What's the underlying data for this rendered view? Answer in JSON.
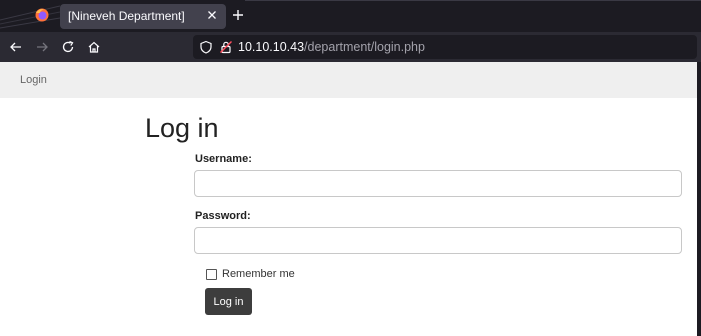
{
  "browser": {
    "tab_title": "[Nineveh Department]",
    "url_host": "10.10.10.43",
    "url_path": "/department/login.php"
  },
  "page": {
    "nav_link": "Login",
    "heading": "Log in",
    "username_label": "Username:",
    "username_value": "",
    "password_label": "Password:",
    "password_value": "",
    "remember_label": "Remember me",
    "remember_checked": false,
    "submit_label": "Log in"
  },
  "colors": {
    "browser_bg": "#1c1b22",
    "toolbar_bg": "#2b2a33",
    "active_tab": "#42414d",
    "nav_bg": "#efefef",
    "button_bg": "#3d3d3d"
  }
}
